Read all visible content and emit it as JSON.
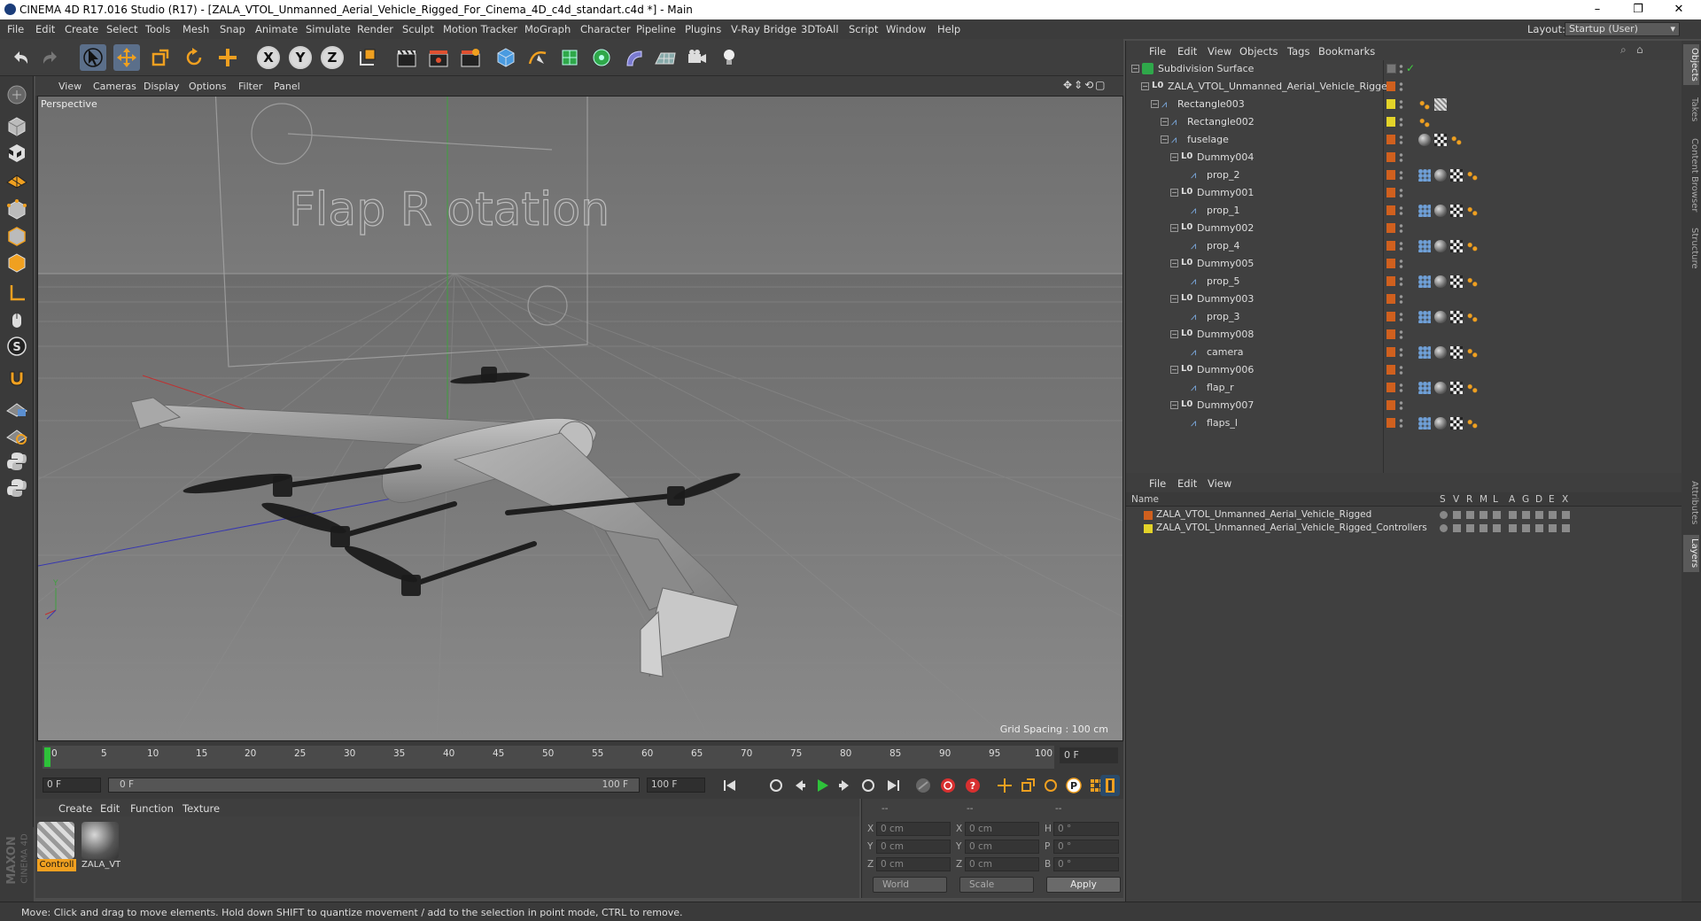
{
  "window": {
    "title": "CINEMA 4D R17.016 Studio (R17) - [ZALA_VTOL_Unmanned_Aerial_Vehicle_Rigged_For_Cinema_4D_c4d_standart.c4d *] - Main",
    "minimize": "–",
    "maximize": "❐",
    "close": "✕"
  },
  "menubar": {
    "items": [
      "File",
      "Edit",
      "Create",
      "Select",
      "Tools",
      "Mesh",
      "Snap",
      "Animate",
      "Simulate",
      "Render",
      "Sculpt",
      "Motion Tracker",
      "MoGraph",
      "Character",
      "Pipeline",
      "Plugins",
      "V-Ray Bridge",
      "3DToAll",
      "Script",
      "Window",
      "Help"
    ],
    "layout_label": "Layout:",
    "layout_value": "Startup (User)"
  },
  "toolbar": {
    "axis_x": "X",
    "axis_y": "Y",
    "axis_z": "Z"
  },
  "viewport": {
    "menu": [
      "View",
      "Cameras",
      "Display",
      "Options",
      "Filter",
      "Panel"
    ],
    "label": "Perspective",
    "grid_spacing": "Grid Spacing : 100 cm",
    "overlay_text": "Flap R otation"
  },
  "timeline": {
    "ticks": [
      "0",
      "5",
      "10",
      "15",
      "20",
      "25",
      "30",
      "35",
      "40",
      "45",
      "50",
      "55",
      "60",
      "65",
      "70",
      "75",
      "80",
      "85",
      "90",
      "95",
      "100"
    ],
    "current_frame": "0 F"
  },
  "transport": {
    "start_field": "0 F",
    "range_start": "0 F",
    "range_end": "100 F",
    "end_field": "100 F"
  },
  "material_manager": {
    "menu": [
      "Create",
      "Edit",
      "Function",
      "Texture"
    ],
    "materials": [
      {
        "label": "Controll"
      },
      {
        "label": "ZALA_VT"
      }
    ]
  },
  "coordinates": {
    "header": [
      "--",
      "--",
      "--"
    ],
    "rows": [
      {
        "a": "X",
        "av": "0 cm",
        "b": "X",
        "bv": "0 cm",
        "c": "H",
        "cv": "0 °"
      },
      {
        "a": "Y",
        "av": "0 cm",
        "b": "Y",
        "bv": "0 cm",
        "c": "P",
        "cv": "0 °"
      },
      {
        "a": "Z",
        "av": "0 cm",
        "b": "Z",
        "bv": "0 cm",
        "c": "B",
        "cv": "0 °"
      }
    ],
    "world": "World",
    "scale": "Scale",
    "apply": "Apply"
  },
  "status": {
    "text": "Move: Click and drag to move elements. Hold down SHIFT to quantize movement / add to the selection in point mode, CTRL to remove."
  },
  "object_manager": {
    "menu": [
      "File",
      "Edit",
      "View",
      "Objects",
      "Tags",
      "Bookmarks"
    ],
    "objects": [
      {
        "name": "Subdivision Surface",
        "type": "subdiv"
      },
      {
        "name": "ZALA_VTOL_Unmanned_Aerial_Vehicle_Rigged",
        "type": "null"
      },
      {
        "name": "Rectangle003",
        "type": "spline"
      },
      {
        "name": "Rectangle002",
        "type": "spline"
      },
      {
        "name": "fuselage",
        "type": "spline"
      },
      {
        "name": "Dummy004",
        "type": "null"
      },
      {
        "name": "prop_2",
        "type": "spline"
      },
      {
        "name": "Dummy001",
        "type": "null"
      },
      {
        "name": "prop_1",
        "type": "spline"
      },
      {
        "name": "Dummy002",
        "type": "null"
      },
      {
        "name": "prop_4",
        "type": "spline"
      },
      {
        "name": "Dummy005",
        "type": "null"
      },
      {
        "name": "prop_5",
        "type": "spline"
      },
      {
        "name": "Dummy003",
        "type": "null"
      },
      {
        "name": "prop_3",
        "type": "spline"
      },
      {
        "name": "Dummy008",
        "type": "null"
      },
      {
        "name": "camera",
        "type": "spline"
      },
      {
        "name": "Dummy006",
        "type": "null"
      },
      {
        "name": "flap_r",
        "type": "spline"
      },
      {
        "name": "Dummy007",
        "type": "null"
      },
      {
        "name": "flaps_l",
        "type": "spline"
      }
    ]
  },
  "layer_manager": {
    "menu": [
      "File",
      "Edit",
      "View"
    ],
    "columns": [
      "Name",
      "S",
      "V",
      "R",
      "M",
      "L",
      "A",
      "G",
      "D",
      "E",
      "X"
    ],
    "layers": [
      {
        "name": "ZALA_VTOL_Unmanned_Aerial_Vehicle_Rigged",
        "color": "#d0601e"
      },
      {
        "name": "ZALA_VTOL_Unmanned_Aerial_Vehicle_Rigged_Controllers",
        "color": "#e3d329"
      }
    ]
  },
  "right_tabs": [
    "Objects",
    "Takes",
    "Content Browser",
    "Structure",
    "Attributes",
    "Layers"
  ],
  "maxon": {
    "brand": "MAXON",
    "product": "CINEMA 4D"
  }
}
